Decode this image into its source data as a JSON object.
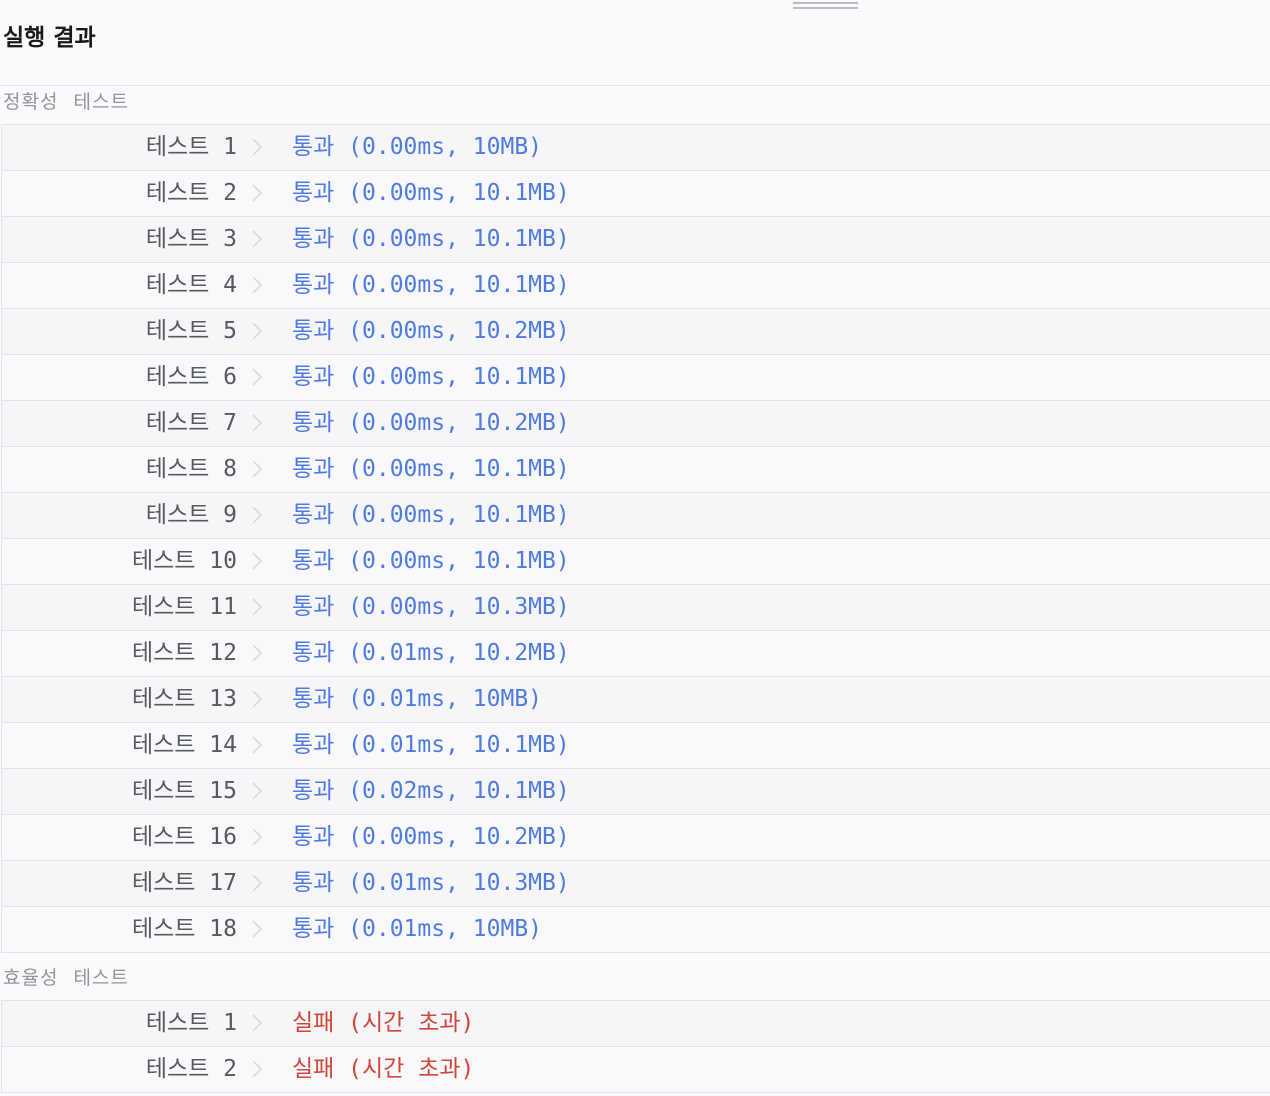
{
  "header": {
    "title": "실행 결과"
  },
  "sections": {
    "correctness": {
      "label": "정확성  테스트",
      "rows": [
        {
          "name": "테스트 1",
          "result": "통과 (0.00ms, 10MB)"
        },
        {
          "name": "테스트 2",
          "result": "통과 (0.00ms, 10.1MB)"
        },
        {
          "name": "테스트 3",
          "result": "통과 (0.00ms, 10.1MB)"
        },
        {
          "name": "테스트 4",
          "result": "통과 (0.00ms, 10.1MB)"
        },
        {
          "name": "테스트 5",
          "result": "통과 (0.00ms, 10.2MB)"
        },
        {
          "name": "테스트 6",
          "result": "통과 (0.00ms, 10.1MB)"
        },
        {
          "name": "테스트 7",
          "result": "통과 (0.00ms, 10.2MB)"
        },
        {
          "name": "테스트 8",
          "result": "통과 (0.00ms, 10.1MB)"
        },
        {
          "name": "테스트 9",
          "result": "통과 (0.00ms, 10.1MB)"
        },
        {
          "name": "테스트 10",
          "result": "통과 (0.00ms, 10.1MB)"
        },
        {
          "name": "테스트 11",
          "result": "통과 (0.00ms, 10.3MB)"
        },
        {
          "name": "테스트 12",
          "result": "통과 (0.01ms, 10.2MB)"
        },
        {
          "name": "테스트 13",
          "result": "통과 (0.01ms, 10MB)"
        },
        {
          "name": "테스트 14",
          "result": "통과 (0.01ms, 10.1MB)"
        },
        {
          "name": "테스트 15",
          "result": "통과 (0.02ms, 10.1MB)"
        },
        {
          "name": "테스트 16",
          "result": "통과 (0.00ms, 10.2MB)"
        },
        {
          "name": "테스트 17",
          "result": "통과 (0.01ms, 10.3MB)"
        },
        {
          "name": "테스트 18",
          "result": "통과 (0.01ms, 10MB)"
        }
      ]
    },
    "efficiency": {
      "label": "효율성  테스트",
      "rows": [
        {
          "name": "테스트 1",
          "result": "실패 (시간 초과)"
        },
        {
          "name": "테스트 2",
          "result": "실패 (시간 초과)"
        }
      ]
    }
  },
  "colors": {
    "pass": "#4f7be3",
    "fail": "#d0463a"
  },
  "icons": {
    "row_arrow": "chevron-right-icon",
    "resize": "drag-handle-icon"
  }
}
